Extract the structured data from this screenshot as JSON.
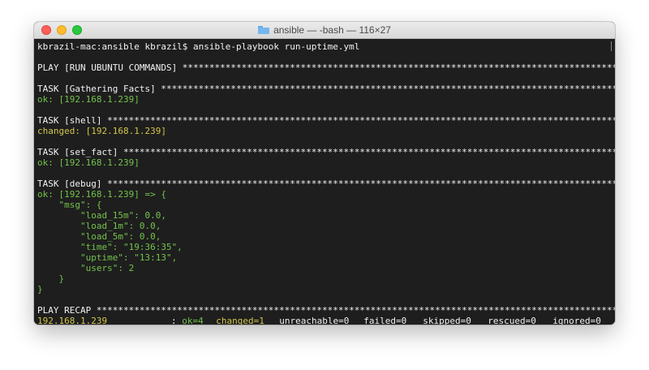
{
  "window": {
    "title": "ansible — -bash — 116×27",
    "folder_icon": "folder-icon"
  },
  "colors": {
    "ok": "#73c34b",
    "changed": "#d3c64a",
    "text": "#f2f2f2",
    "background": "#1e1e1e"
  },
  "terminal": {
    "prompt_line": "kbrazil-mac:ansible kbrazil$ ansible-playbook run-uptime.yml",
    "play": "PLAY [RUN UBUNTU COMMANDS] ********************************************************************************************",
    "task_gather": "TASK [Gathering Facts] ************************************************************************************************",
    "ok_gather": "ok: [192.168.1.239]",
    "task_shell": "TASK [shell] **********************************************************************************************************",
    "changed_shell": "changed: [192.168.1.239]",
    "task_set_fact": "TASK [set_fact] *******************************************************************************************************",
    "ok_set_fact": "ok: [192.168.1.239]",
    "task_debug": "TASK [debug] **********************************************************************************************************",
    "debug_lines": [
      "ok: [192.168.1.239] => {",
      "    \"msg\": {",
      "        \"load_15m\": 0.0,",
      "        \"load_1m\": 0.0,",
      "        \"load_5m\": 0.0,",
      "        \"time\": \"19:36:35\",",
      "        \"uptime\": \"13:13\",",
      "        \"users\": 2",
      "    }",
      "}"
    ],
    "play_recap": "PLAY RECAP ************************************************************************************************************",
    "recap": {
      "host": "192.168.1.239",
      "sep": ": ",
      "ok": "ok=4",
      "changed": "changed=1",
      "unreachable": "unreachable=0",
      "failed": "failed=0",
      "skipped": "skipped=0",
      "rescued": "rescued=0",
      "ignored": "ignored=0"
    }
  }
}
